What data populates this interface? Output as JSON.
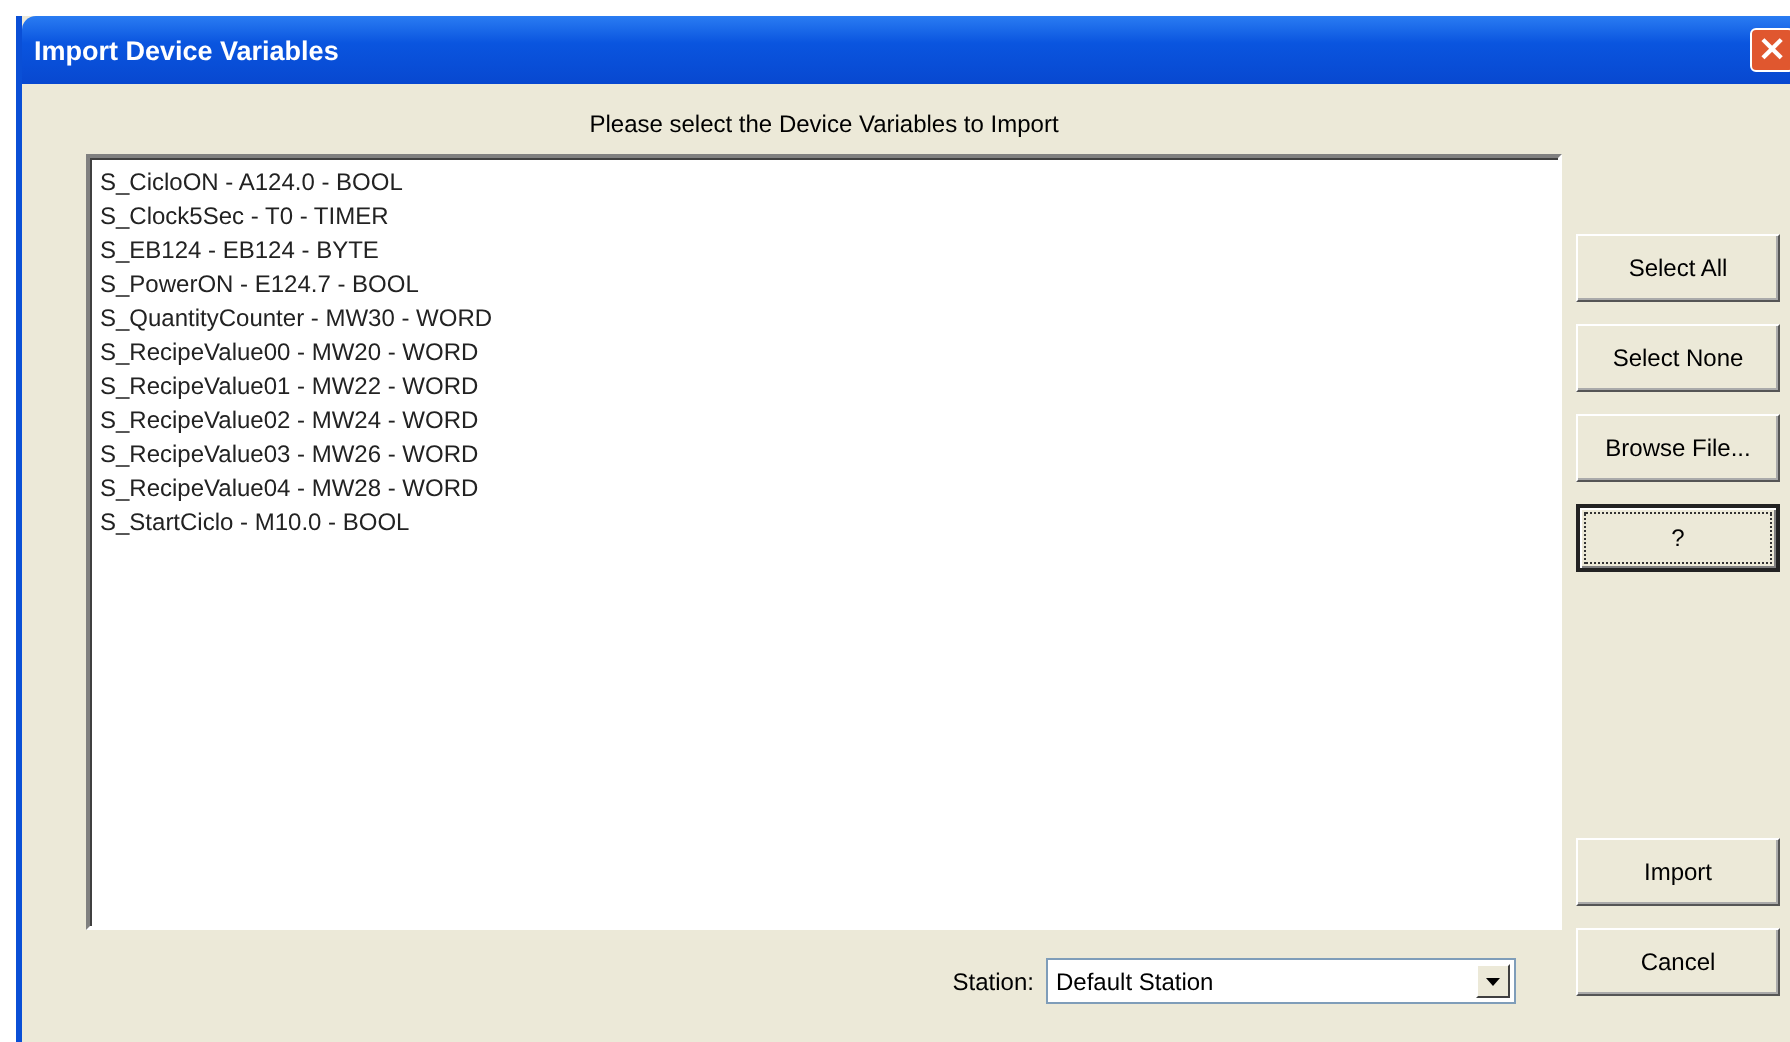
{
  "window": {
    "title": "Import Device Variables",
    "close": "×"
  },
  "prompt": "Please select the Device Variables to Import",
  "variables": [
    {
      "label": "S_CicloON - A124.0 - BOOL",
      "selected": false
    },
    {
      "label": "S_Clock5Sec - T0 - TIMER",
      "selected": false
    },
    {
      "label": "S_EB124 - EB124 - BYTE",
      "selected": false
    },
    {
      "label": "S_PowerON - E124.7 - BOOL",
      "selected": false
    },
    {
      "label": "S_QuantityCounter - MW30 - WORD",
      "selected": false
    },
    {
      "label": "S_RecipeValue00 - MW20 - WORD",
      "selected": false
    },
    {
      "label": "S_RecipeValue01 - MW22 - WORD",
      "selected": false
    },
    {
      "label": "S_RecipeValue02 - MW24 - WORD",
      "selected": false
    },
    {
      "label": "S_RecipeValue03 - MW26 - WORD",
      "selected": false
    },
    {
      "label": "S_RecipeValue04 - MW28 - WORD",
      "selected": false
    },
    {
      "label": "S_StartCiclo - M10.0 - BOOL",
      "selected": false
    }
  ],
  "top_buttons": [
    {
      "label": "Select All",
      "focused": false
    },
    {
      "label": "Select None",
      "focused": false
    },
    {
      "label": "Browse File...",
      "focused": false
    },
    {
      "label": "?",
      "focused": true
    }
  ],
  "bottom_buttons": [
    {
      "label": "Import",
      "focused": false
    },
    {
      "label": "Cancel",
      "focused": false
    }
  ],
  "station": {
    "label": "Station:",
    "value": "Default Station"
  }
}
